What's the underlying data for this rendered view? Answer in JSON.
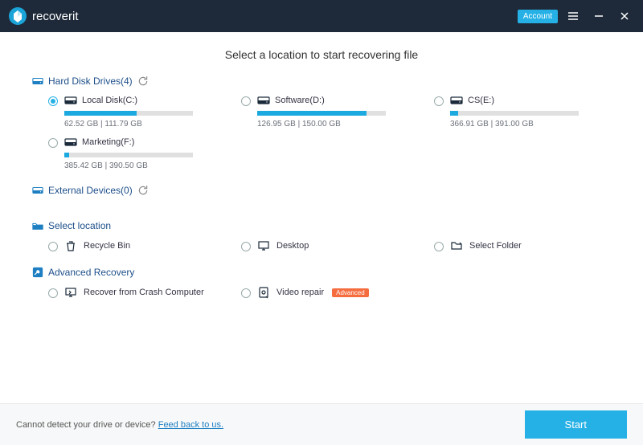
{
  "header": {
    "brand": "recoverit",
    "account_label": "Account"
  },
  "title": "Select a location to start recovering file",
  "sections": {
    "hard_disk": {
      "label": "Hard Disk Drives(4)",
      "drives": [
        {
          "name": "Local Disk(C:)",
          "used": 62.52,
          "total": 111.79,
          "stats": "62.52  GB | 111.79  GB",
          "selected": true,
          "pct": 56
        },
        {
          "name": "Software(D:)",
          "used": 126.95,
          "total": 150.0,
          "stats": "126.95  GB | 150.00  GB",
          "selected": false,
          "pct": 85
        },
        {
          "name": "CS(E:)",
          "used": 366.91,
          "total": 391.0,
          "stats": "366.91  GB | 391.00  GB",
          "selected": false,
          "pct": 6
        },
        {
          "name": "Marketing(F:)",
          "used": 385.42,
          "total": 390.5,
          "stats": "385.42  GB | 390.50  GB",
          "selected": false,
          "pct": 4
        }
      ]
    },
    "external": {
      "label": "External Devices(0)"
    },
    "select_location": {
      "label": "Select location",
      "items": [
        {
          "name": "Recycle Bin"
        },
        {
          "name": "Desktop"
        },
        {
          "name": "Select Folder"
        }
      ]
    },
    "advanced": {
      "label": "Advanced Recovery",
      "items": [
        {
          "name": "Recover from Crash Computer",
          "badge": ""
        },
        {
          "name": "Video repair",
          "badge": "Advanced"
        }
      ]
    }
  },
  "footer": {
    "text": "Cannot detect your drive or device? ",
    "link": "Feed back to us.",
    "start": "Start"
  }
}
